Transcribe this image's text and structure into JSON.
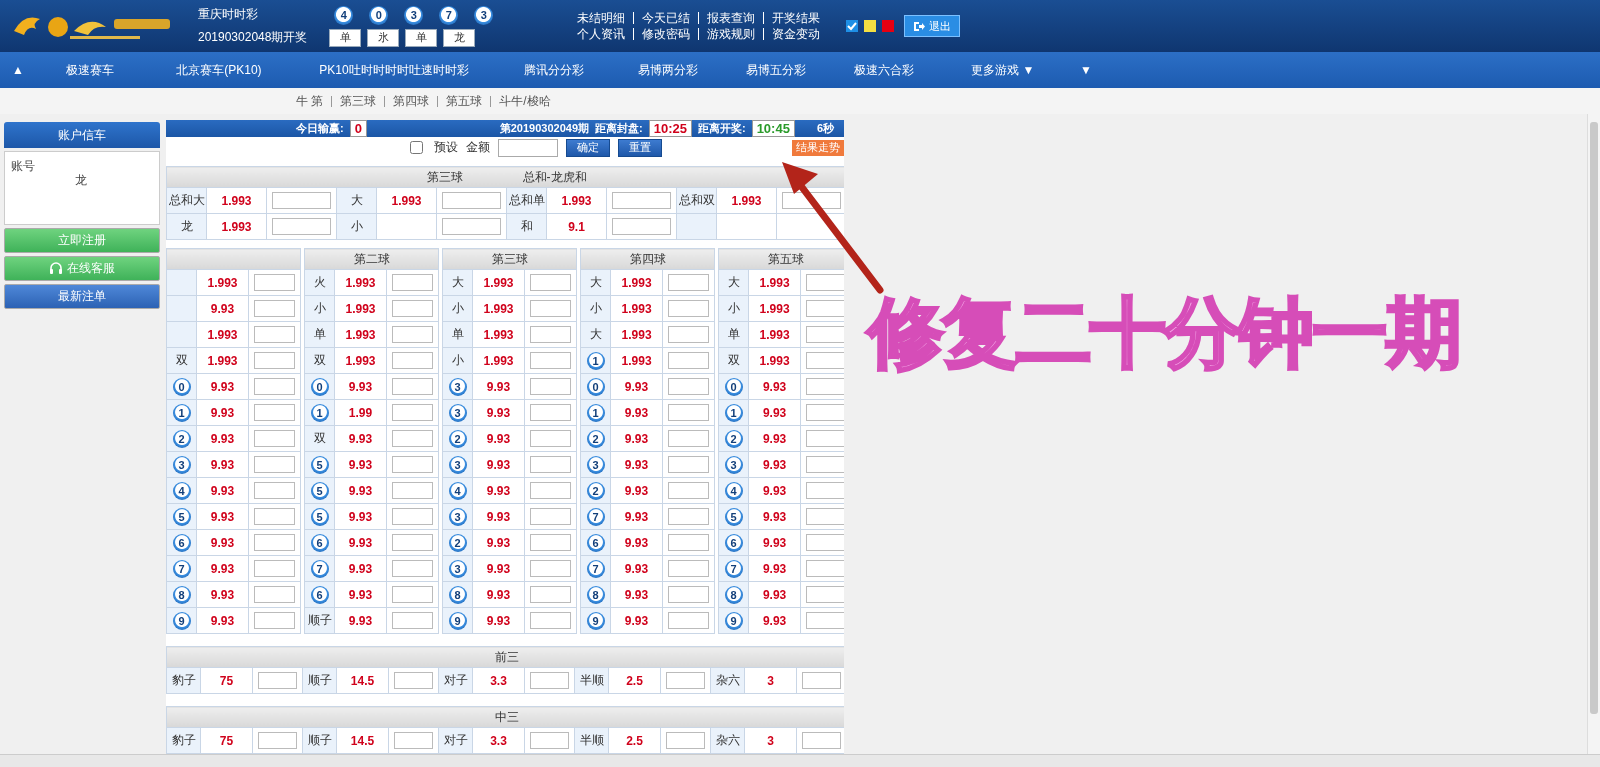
{
  "header": {
    "game": "重庆时时彩",
    "draw": "20190302048期开奖",
    "balls": [
      "4",
      "0",
      "3",
      "7",
      "3"
    ],
    "tags": [
      "单",
      "氷",
      "单",
      "龙"
    ],
    "links": [
      [
        "未结明细",
        "今天已结",
        "报表查询",
        "开奖结果"
      ],
      [
        "个人资讯",
        "修改密码",
        "游戏规则",
        "资金变动"
      ]
    ],
    "themes": [
      {
        "color": "#1e8fe6",
        "selected": true
      },
      {
        "color": "#f5e042",
        "selected": false
      },
      {
        "color": "#e60012",
        "selected": false
      }
    ],
    "logout": "退出"
  },
  "nav": {
    "toggle": "▲",
    "items": [
      "极速赛车",
      "北京赛车(PK10)",
      "PK10吐时时时时吐速时时彩",
      "腾讯分分彩",
      "易博两分彩",
      "易博五分彩",
      "极速六合彩",
      "更多游戏 ▼"
    ],
    "more_toggle": "▼"
  },
  "subnav": [
    "牛 第",
    "第三球",
    "第四球",
    "第五球",
    "斗牛/梭哈"
  ],
  "sidebar": {
    "title": "账户信车",
    "account_label": "账号",
    "account_value": "龙",
    "buttons": [
      {
        "label": "立即注册",
        "kind": "register"
      },
      {
        "label": "在线客服",
        "kind": "support"
      },
      {
        "label": "最新注单",
        "kind": "orders"
      }
    ]
  },
  "info_bar": {
    "today_label": "今日输赢:",
    "today_value": "0",
    "issue": "第20190302049期",
    "close_label": "距离封盘:",
    "close_time": "10:25",
    "draw_label": "距离开奖:",
    "draw_time": "10:45",
    "seconds": "6秒"
  },
  "controls": {
    "preset_label": "预设",
    "preset_checked": false,
    "amount_label": "金额",
    "confirm": "确定",
    "reset": "重置",
    "trend": "结果走势"
  },
  "sum_table": {
    "titles": [
      "第三球",
      "总和-龙虎和"
    ],
    "rows": [
      [
        {
          "label": "总和大",
          "odds": "1.993"
        },
        {
          "label": "大",
          "odds": "1.993"
        },
        {
          "label": "总和单",
          "odds": "1.993"
        },
        {
          "label": "总和双",
          "odds": "1.993"
        }
      ],
      [
        {
          "label": "龙",
          "odds": "1.993"
        },
        {
          "label": "小"
        },
        {
          "label": "和",
          "odds": "9.1"
        },
        {}
      ]
    ]
  },
  "ball_columns": [
    {
      "cells": [
        {
          "kind": "text",
          "odds": "1.993"
        },
        {
          "kind": "text",
          "odds": "9.93"
        },
        {
          "kind": "text",
          "odds": "1.993"
        },
        {
          "kind": "text",
          "label": "双",
          "odds": "1.993"
        },
        {
          "kind": "ball",
          "label": "0",
          "odds": "9.93"
        },
        {
          "kind": "ball",
          "label": "1",
          "odds": "9.93"
        },
        {
          "kind": "ball",
          "label": "2",
          "odds": "9.93"
        },
        {
          "kind": "ball",
          "label": "3",
          "odds": "9.93"
        },
        {
          "kind": "ball",
          "label": "4",
          "odds": "9.93"
        },
        {
          "kind": "ball",
          "label": "5",
          "odds": "9.93"
        },
        {
          "kind": "ball",
          "label": "6",
          "odds": "9.93"
        },
        {
          "kind": "ball",
          "label": "7",
          "odds": "9.93"
        },
        {
          "kind": "ball",
          "label": "8",
          "odds": "9.93"
        },
        {
          "kind": "ball",
          "label": "9",
          "odds": "9.93"
        }
      ]
    },
    {
      "title": "第二球",
      "cells": [
        {
          "kind": "text",
          "label": "火",
          "odds": "1.993"
        },
        {
          "kind": "text",
          "label": "小",
          "odds": "1.993"
        },
        {
          "kind": "text",
          "label": "单",
          "odds": "1.993"
        },
        {
          "kind": "text",
          "label": "双",
          "odds": "1.993"
        },
        {
          "kind": "ball",
          "label": "0",
          "odds": "9.93"
        },
        {
          "kind": "ball",
          "label": "1",
          "odds": "1.99"
        },
        {
          "kind": "text",
          "label": "双",
          "odds": "9.93"
        },
        {
          "kind": "ball",
          "label": "5",
          "odds": "9.93"
        },
        {
          "kind": "ball",
          "label": "5",
          "odds": "9.93"
        },
        {
          "kind": "ball",
          "label": "5",
          "odds": "9.93"
        },
        {
          "kind": "ball",
          "label": "6",
          "odds": "9.93"
        },
        {
          "kind": "ball",
          "label": "7",
          "odds": "9.93"
        },
        {
          "kind": "ball",
          "label": "6",
          "odds": "9.93"
        },
        {
          "kind": "text",
          "label": "顺子",
          "odds": "9.93"
        }
      ]
    },
    {
      "title": "第三球",
      "cells": [
        {
          "kind": "text",
          "label": "大",
          "odds": "1.993"
        },
        {
          "kind": "text",
          "label": "小",
          "odds": "1.993"
        },
        {
          "kind": "text",
          "label": "单",
          "odds": "1.993"
        },
        {
          "kind": "text",
          "label": "小",
          "odds": "1.993"
        },
        {
          "kind": "ball",
          "label": "3",
          "odds": "9.93"
        },
        {
          "kind": "ball",
          "label": "3",
          "odds": "9.93"
        },
        {
          "kind": "ball",
          "label": "2",
          "odds": "9.93"
        },
        {
          "kind": "ball",
          "label": "3",
          "odds": "9.93"
        },
        {
          "kind": "ball",
          "label": "4",
          "odds": "9.93"
        },
        {
          "kind": "ball",
          "label": "3",
          "odds": "9.93"
        },
        {
          "kind": "ball",
          "label": "2",
          "odds": "9.93"
        },
        {
          "kind": "ball",
          "label": "3",
          "odds": "9.93"
        },
        {
          "kind": "ball",
          "label": "8",
          "odds": "9.93"
        },
        {
          "kind": "ball",
          "label": "9",
          "odds": "9.93"
        }
      ]
    },
    {
      "title": "第四球",
      "cells": [
        {
          "kind": "text",
          "label": "大",
          "odds": "1.993"
        },
        {
          "kind": "text",
          "label": "小",
          "odds": "1.993"
        },
        {
          "kind": "text",
          "label": "大",
          "odds": "1.993"
        },
        {
          "kind": "ball",
          "label": "1",
          "odds": "1.993"
        },
        {
          "kind": "ball",
          "label": "0",
          "odds": "9.93"
        },
        {
          "kind": "ball",
          "label": "1",
          "odds": "9.93"
        },
        {
          "kind": "ball",
          "label": "2",
          "odds": "9.93"
        },
        {
          "kind": "ball",
          "label": "3",
          "odds": "9.93"
        },
        {
          "kind": "ball",
          "label": "2",
          "odds": "9.93"
        },
        {
          "kind": "ball",
          "label": "7",
          "odds": "9.93"
        },
        {
          "kind": "ball",
          "label": "6",
          "odds": "9.93"
        },
        {
          "kind": "ball",
          "label": "7",
          "odds": "9.93"
        },
        {
          "kind": "ball",
          "label": "8",
          "odds": "9.93"
        },
        {
          "kind": "ball",
          "label": "9",
          "odds": "9.93"
        }
      ]
    },
    {
      "title": "第五球",
      "cells": [
        {
          "kind": "text",
          "label": "大",
          "odds": "1.993"
        },
        {
          "kind": "text",
          "label": "小",
          "odds": "1.993"
        },
        {
          "kind": "text",
          "label": "单",
          "odds": "1.993"
        },
        {
          "kind": "text",
          "label": "双",
          "odds": "1.993"
        },
        {
          "kind": "ball",
          "label": "0",
          "odds": "9.93"
        },
        {
          "kind": "ball",
          "label": "1",
          "odds": "9.93"
        },
        {
          "kind": "ball",
          "label": "2",
          "odds": "9.93"
        },
        {
          "kind": "ball",
          "label": "3",
          "odds": "9.93"
        },
        {
          "kind": "ball",
          "label": "4",
          "odds": "9.93"
        },
        {
          "kind": "ball",
          "label": "5",
          "odds": "9.93"
        },
        {
          "kind": "ball",
          "label": "6",
          "odds": "9.93"
        },
        {
          "kind": "ball",
          "label": "7",
          "odds": "9.93"
        },
        {
          "kind": "ball",
          "label": "8",
          "odds": "9.93"
        },
        {
          "kind": "ball",
          "label": "9",
          "odds": "9.93"
        }
      ]
    }
  ],
  "combo_tables": [
    {
      "title": "前三",
      "items": [
        {
          "label": "豹子",
          "odds": "75"
        },
        {
          "label": "顺子",
          "odds": "14.5"
        },
        {
          "label": "对子",
          "odds": "3.3"
        },
        {
          "label": "半顺",
          "odds": "2.5"
        },
        {
          "label": "杂六",
          "odds": "3"
        }
      ]
    },
    {
      "title": "中三",
      "items": [
        {
          "label": "豹子",
          "odds": "75"
        },
        {
          "label": "顺子",
          "odds": "14.5"
        },
        {
          "label": "对子",
          "odds": "3.3"
        },
        {
          "label": "半顺",
          "odds": "2.5"
        },
        {
          "label": "杂六",
          "odds": "3"
        }
      ]
    }
  ],
  "annotation": {
    "text": "修复二十分钟一期"
  }
}
